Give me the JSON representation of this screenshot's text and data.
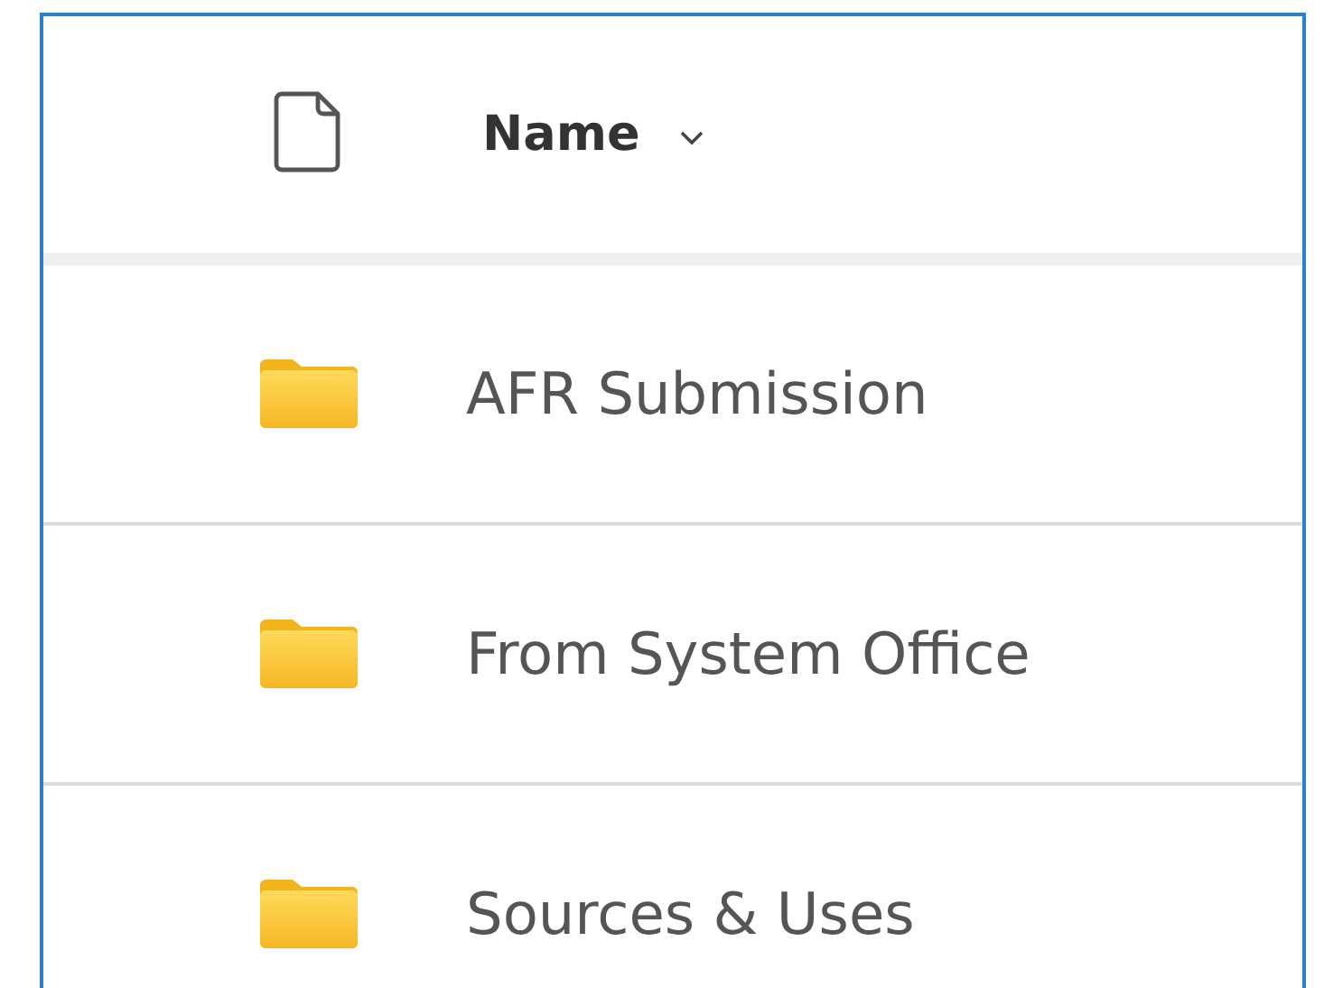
{
  "header": {
    "column_label": "Name"
  },
  "rows": [
    {
      "name": "AFR Submission",
      "kind": "folder"
    },
    {
      "name": "From System Office",
      "kind": "folder"
    },
    {
      "name": "Sources & Uses",
      "kind": "folder"
    }
  ]
}
